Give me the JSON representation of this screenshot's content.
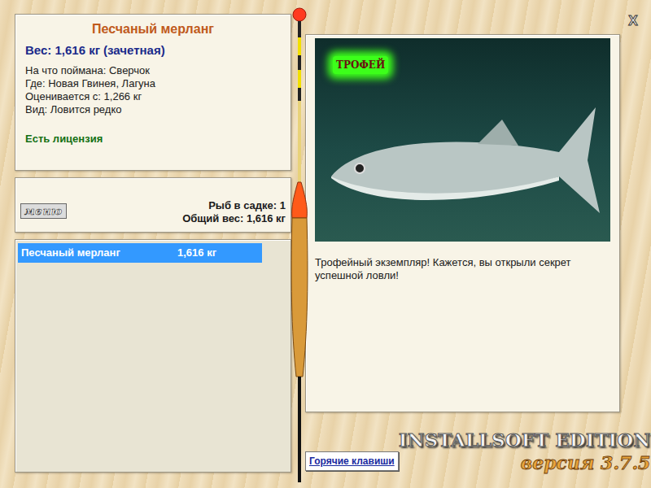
{
  "window": {
    "close": "X"
  },
  "fish": {
    "title": "Песчаный мерланг",
    "weight": "Вес: 1,616 кг (зачетная)",
    "details": [
      "На что поймана: Сверчок",
      "Где: Новая Гвинея, Лагуна",
      "Оценивается с: 1,266 кг",
      "Вид: Ловится редко"
    ],
    "license": "Есть лицензия"
  },
  "menu_button": "меню",
  "keepnet": {
    "count": "Рыб в садке: 1",
    "total": "Общий вес: 1,616 кг"
  },
  "catch_list": [
    {
      "name": "Песчаный мерланг",
      "weight": "1,616 кг",
      "selected": true
    }
  ],
  "photo": {
    "badge": "ТРОФЕЙ"
  },
  "message": "Трофейный экземпляр! Кажется, вы открыли секрет успешной ловли!",
  "hotkeys_button": "Горячие клавиши",
  "logo": {
    "title": "INSTALLSOFT EDITION",
    "version": "версия 3.7.5"
  }
}
